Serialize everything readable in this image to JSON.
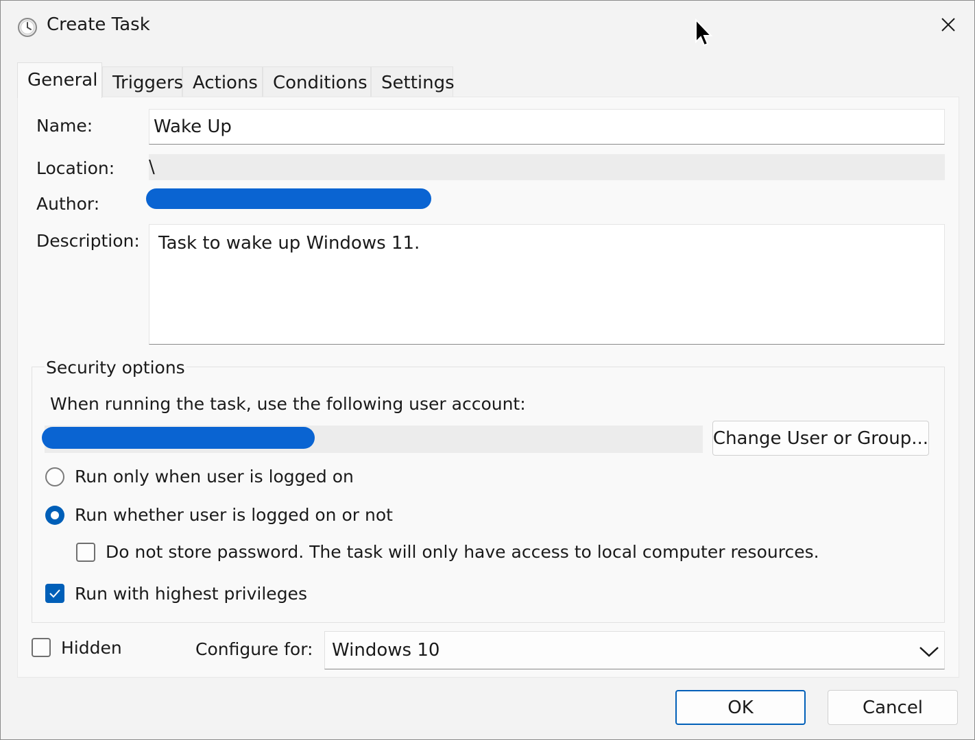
{
  "window": {
    "title": "Create Task",
    "close_glyph": "✕"
  },
  "tabs": [
    {
      "label": "General",
      "active": true
    },
    {
      "label": "Triggers",
      "active": false
    },
    {
      "label": "Actions",
      "active": false
    },
    {
      "label": "Conditions",
      "active": false
    },
    {
      "label": "Settings",
      "active": false
    }
  ],
  "general": {
    "name_label": "Name:",
    "name_value": "Wake Up",
    "location_label": "Location:",
    "location_value": "\\",
    "author_label": "Author:",
    "description_label": "Description:",
    "description_value": "Task to wake up Windows 11."
  },
  "security": {
    "title": "Security options",
    "account_prompt": "When running the task, use the following user account:",
    "change_button": "Change User or Group...",
    "run_logged_on": "Run only when user is logged on",
    "run_whether": "Run whether user is logged on or not",
    "do_not_store": "Do not store password.  The task will only have access to local computer resources.",
    "highest_privileges": "Run with highest privileges",
    "selected_run_mode": "run_whether",
    "do_not_store_checked": false,
    "highest_privileges_checked": true
  },
  "footer": {
    "hidden_label": "Hidden",
    "hidden_checked": false,
    "configure_label": "Configure for:",
    "configure_value": "Windows 10",
    "ok_label": "OK",
    "cancel_label": "Cancel"
  },
  "colors": {
    "accent": "#005fb8",
    "redaction": "#0a64d2"
  },
  "icons": [
    "clock-icon",
    "close-icon",
    "mouse-cursor-icon",
    "checkmark-icon",
    "chevron-down-icon"
  ]
}
